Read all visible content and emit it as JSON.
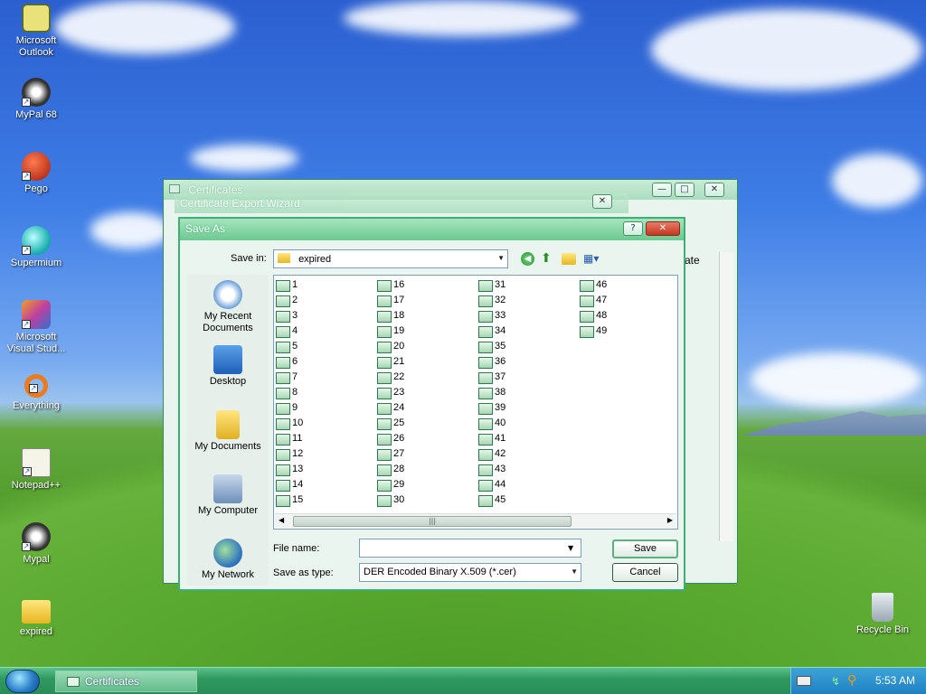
{
  "desktop": {
    "icons": [
      {
        "label": "Microsoft Outlook",
        "icon": "outlook-icon"
      },
      {
        "label": "MyPal 68",
        "icon": "mypal-icon"
      },
      {
        "label": "Pego",
        "icon": "pego-icon"
      },
      {
        "label": "Supermium",
        "icon": "supermium-icon"
      },
      {
        "label": "Microsoft Visual Stud...",
        "icon": "visual-studio-icon"
      },
      {
        "label": "Everything",
        "icon": "everything-icon"
      },
      {
        "label": "Notepad++",
        "icon": "notepadpp-icon"
      },
      {
        "label": "Mypal",
        "icon": "mypal-icon"
      },
      {
        "label": "expired",
        "icon": "folder-icon"
      },
      {
        "label": "Recycle Bin",
        "icon": "recycle-bin-icon"
      }
    ]
  },
  "windows": {
    "certificates_title": "Certificates",
    "wizard_title": "Certificate Export Wizard",
    "bg_column_fragment": "ate"
  },
  "save_as": {
    "title": "Save As",
    "save_in_label": "Save in:",
    "save_in_value": "expired",
    "places": [
      "My Recent Documents",
      "Desktop",
      "My Documents",
      "My Computer",
      "My Network"
    ],
    "files": [
      "1",
      "2",
      "3",
      "4",
      "5",
      "6",
      "7",
      "8",
      "9",
      "10",
      "11",
      "12",
      "13",
      "14",
      "15",
      "16",
      "17",
      "18",
      "19",
      "20",
      "21",
      "22",
      "23",
      "24",
      "25",
      "26",
      "27",
      "28",
      "29",
      "30",
      "31",
      "32",
      "33",
      "34",
      "35",
      "36",
      "37",
      "38",
      "39",
      "40",
      "41",
      "42",
      "43",
      "44",
      "45",
      "46",
      "47",
      "48",
      "49"
    ],
    "file_name_label": "File name:",
    "file_name_value": "",
    "save_as_type_label": "Save as type:",
    "save_as_type_value": "DER Encoded Binary X.509 (*.cer)",
    "save_button": "Save",
    "cancel_button": "Cancel"
  },
  "taskbar": {
    "task_item": "Certificates",
    "clock": "5:53 AM"
  }
}
